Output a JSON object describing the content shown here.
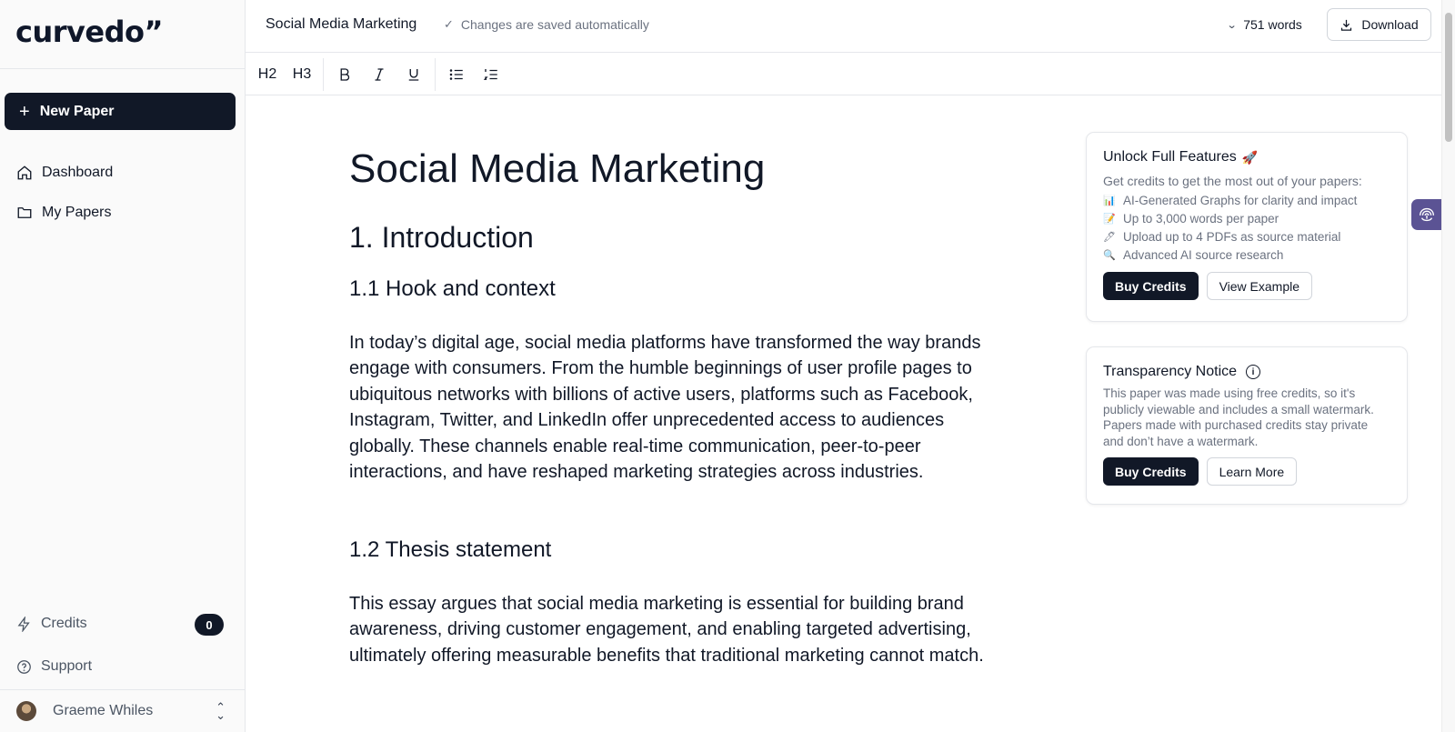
{
  "sidebar": {
    "logo": "curvedo”",
    "new_paper_label": "New Paper",
    "nav": [
      {
        "label": "Dashboard",
        "icon": "home-icon"
      },
      {
        "label": "My Papers",
        "icon": "folder-icon"
      }
    ],
    "credits_label": "Credits",
    "credits_count": "0",
    "support_label": "Support",
    "user_name": "Graeme Whiles"
  },
  "topbar": {
    "title": "Social Media Marketing",
    "saved_status": "Changes are saved automatically",
    "word_count": "751 words",
    "download_label": "Download"
  },
  "toolbar": {
    "h2": "H2",
    "h3": "H3",
    "bold": "B",
    "italic": "I",
    "underline": "U"
  },
  "document": {
    "title": "Social Media Marketing",
    "section1": "1. Introduction",
    "sub1": "1.1 Hook and context",
    "para1": "In today’s digital age, social media platforms have transformed the way brands engage with consumers. From the humble beginnings of user profile pages to ubiquitous networks with billions of active users, platforms such as Facebook, Instagram, Twitter, and LinkedIn offer unprecedented access to audiences globally. These channels enable real-time communication, peer-to-peer interactions, and have reshaped marketing strategies across industries.",
    "sub2": "1.2 Thesis statement",
    "para2": "This essay argues that social media marketing is essential for building brand awareness, driving customer engagement, and enabling targeted advertising, ultimately offering measurable benefits that traditional marketing cannot match."
  },
  "unlock_card": {
    "title": "Unlock Full Features",
    "title_emoji": "🚀",
    "subtitle": "Get credits to get the most out of your papers:",
    "features": [
      {
        "icon": "📊",
        "text": "AI-Generated Graphs for clarity and impact"
      },
      {
        "icon": "📝",
        "text": "Up to 3,000 words per paper"
      },
      {
        "icon": "🖊",
        "text": "Upload up to 4 PDFs as source material"
      },
      {
        "icon": "🔍",
        "text": "Advanced AI source research"
      }
    ],
    "buy_label": "Buy Credits",
    "example_label": "View Example"
  },
  "notice_card": {
    "title": "Transparency Notice",
    "text": "This paper was made using free credits, so it's publicly viewable and includes a small watermark. Papers made with purchased credits stay private and don’t have a watermark.",
    "buy_label": "Buy Credits",
    "learn_label": "Learn More"
  },
  "colors": {
    "primary": "#111827",
    "muted": "#6b7280",
    "accent_tab": "#5b5394"
  }
}
